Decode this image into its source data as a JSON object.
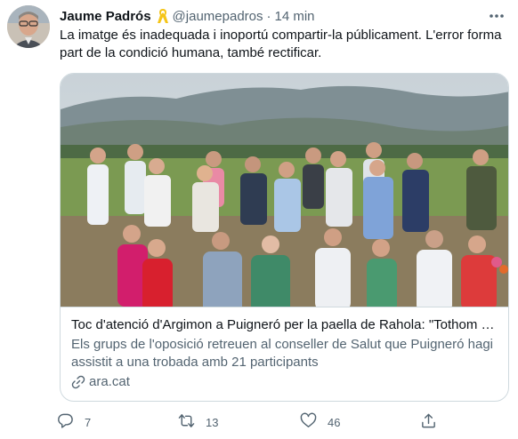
{
  "tweet": {
    "author_name": "Jaume Padrós",
    "handle": "@jaumepadros",
    "separator": "·",
    "time": "14 min",
    "text": "La imatge és inadequada i inoportú compartir-la públicament. L'error forma part de la condició humana, també rectificar."
  },
  "card": {
    "title": "Toc d'atenció d'Argimon a Puigneró per la paella de Rahola: \"Tothom h...",
    "description": "Els grups de l'oposició retreuen al conseller de Salut que Puigneró hagi assistit a una trobada amb 21 participants",
    "domain": "ara.cat"
  },
  "actions": {
    "reply_count": "7",
    "retweet_count": "13",
    "like_count": "46"
  },
  "icons": {
    "ribbon": "yellow-ribbon-icon",
    "more": "more-icon",
    "link": "link-icon",
    "reply": "reply-icon",
    "retweet": "retweet-icon",
    "like": "like-icon",
    "share": "share-icon"
  },
  "colors": {
    "text": "#0f1419",
    "secondary": "#536471",
    "border": "#cfd9de",
    "ribbon": "#f5c518"
  }
}
